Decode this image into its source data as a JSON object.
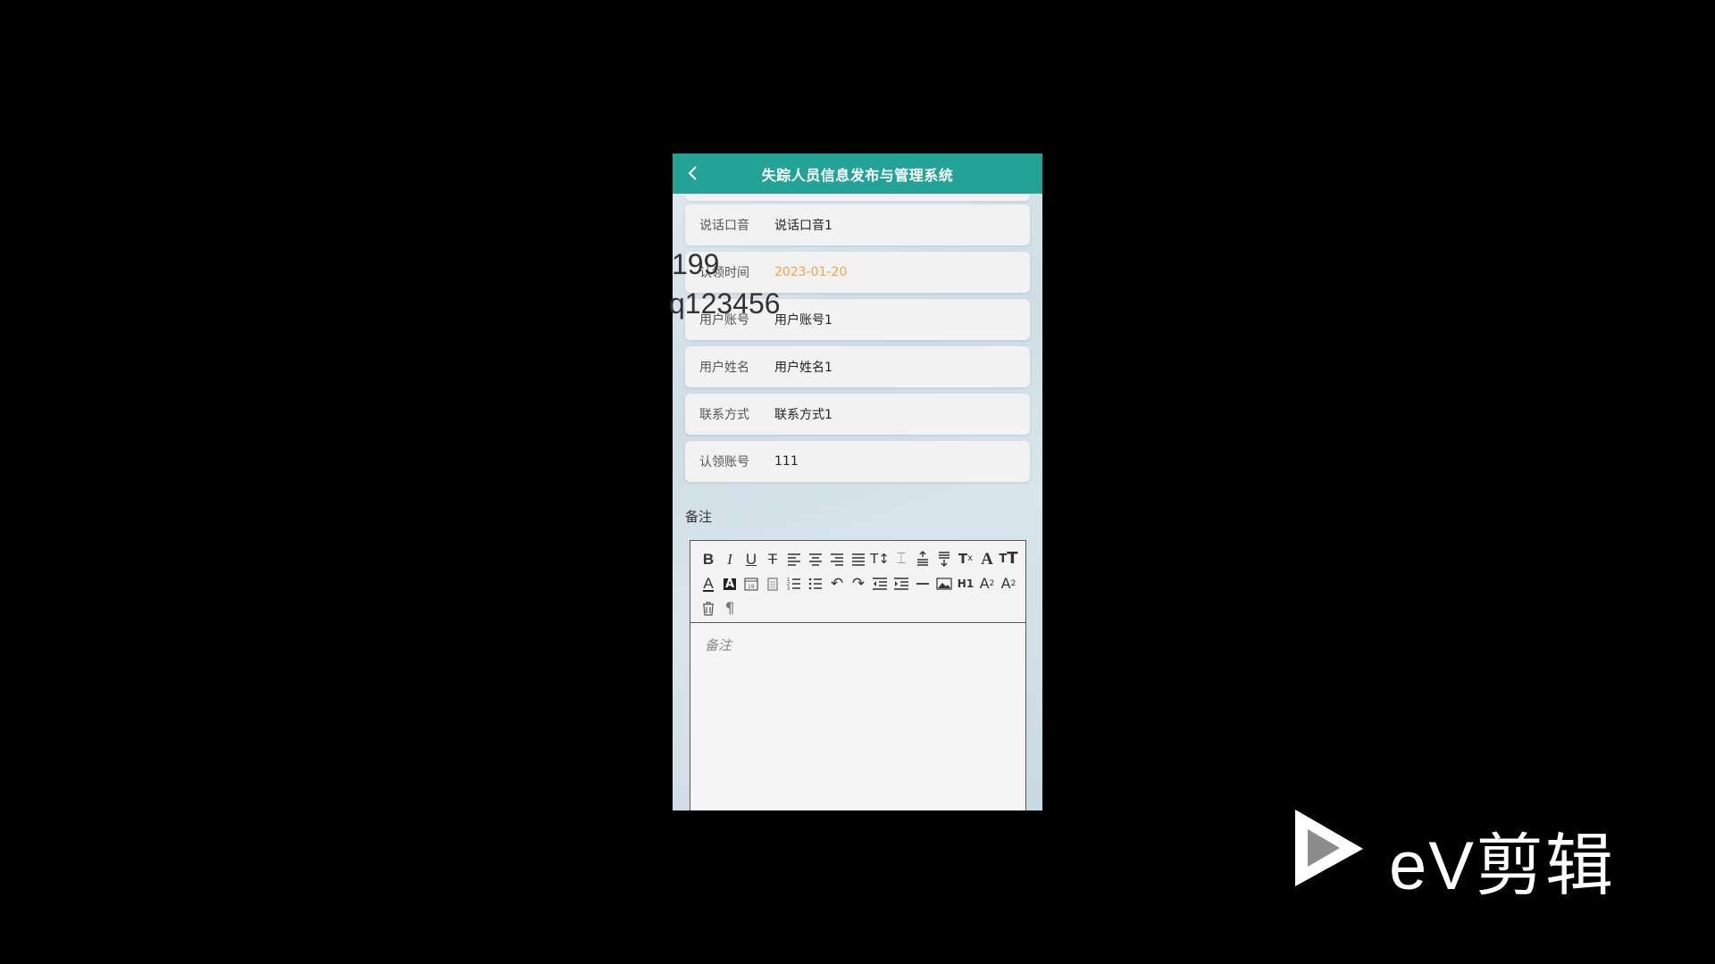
{
  "header": {
    "title": "失踪人员信息发布与管理系统"
  },
  "fields": [
    {
      "label": "说话口音",
      "value": "说话口音1"
    },
    {
      "label": "认领时间",
      "value": "2023-01-20"
    },
    {
      "label": "用户账号",
      "value": "用户账号1"
    },
    {
      "label": "用户姓名",
      "value": "用户姓名1"
    },
    {
      "label": "联系方式",
      "value": "联系方式1"
    },
    {
      "label": "认领账号",
      "value": "111"
    }
  ],
  "remarks": {
    "label": "备注",
    "placeholder": "备注"
  },
  "toolbar": [
    "bold-icon",
    "italic-icon",
    "underline-icon",
    "strikethrough-icon",
    "align-left-icon",
    "align-center-icon",
    "align-right-icon",
    "align-justify-icon",
    "font-size-icon",
    "line-height-icon",
    "paragraph-spacing-above-icon",
    "paragraph-spacing-below-icon",
    "clear-format-icon",
    "font-family-icon",
    "text-size-icon",
    "font-color-icon",
    "background-color-icon",
    "date-icon",
    "paste-icon",
    "ordered-list-icon",
    "unordered-list-icon",
    "undo-icon",
    "redo-icon",
    "outdent-icon",
    "indent-icon",
    "horizontal-rule-icon",
    "image-icon",
    "h1-icon",
    "subscript-icon",
    "superscript-icon",
    "delete-icon",
    "paragraph-mark-icon"
  ],
  "overlay": {
    "line1": "199",
    "line2": "q123456"
  },
  "watermark": {
    "text": "eV剪辑"
  },
  "colors": {
    "header": "#23a396",
    "date": "#f4a24a",
    "background": "#000000"
  }
}
